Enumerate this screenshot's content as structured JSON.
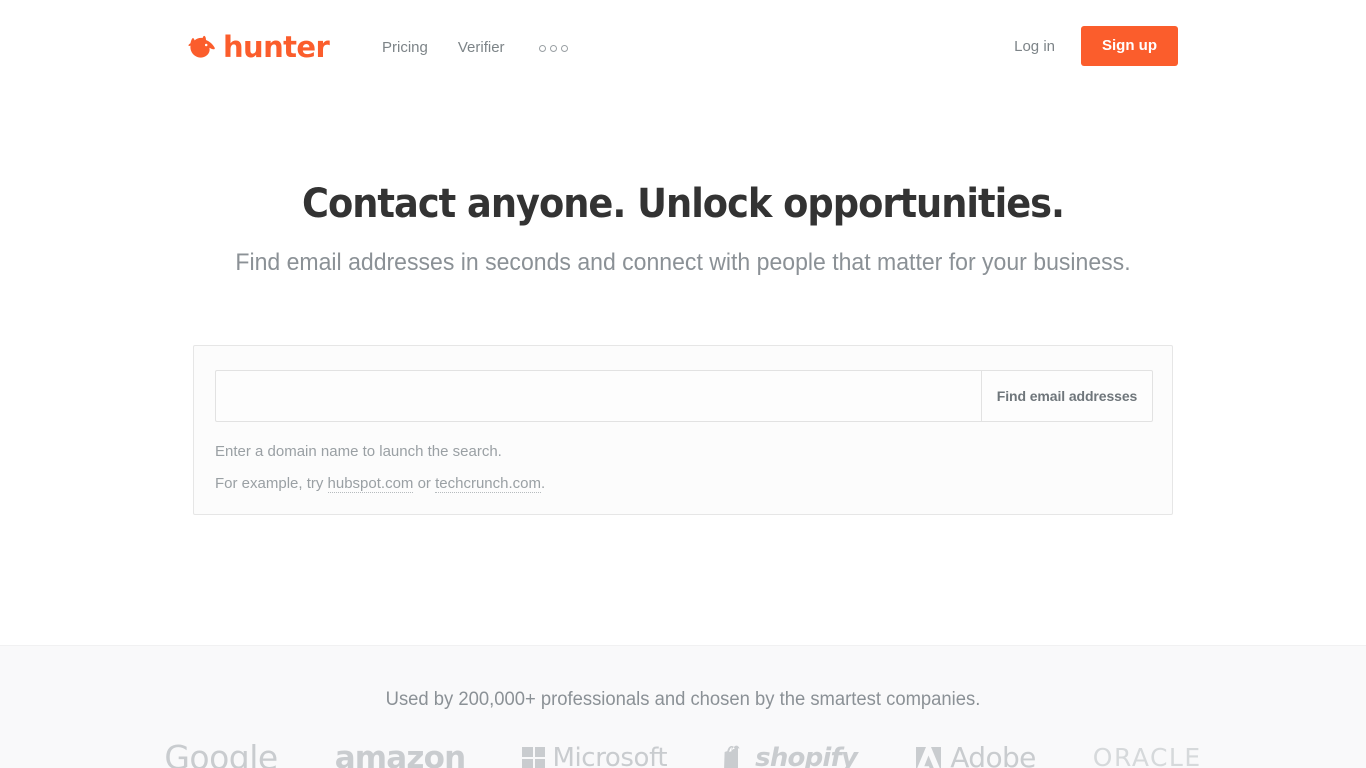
{
  "brand": {
    "name": "hunter",
    "icon": "fox-head-icon",
    "color": "#fb5d2c"
  },
  "header": {
    "nav": [
      {
        "label": "Pricing",
        "name": "pricing"
      },
      {
        "label": "Verifier",
        "name": "verifier"
      }
    ],
    "more_icon": "three-dots-icon",
    "login_label": "Log in",
    "signup_label": "Sign up",
    "signup_color": "#fb5d2c"
  },
  "hero": {
    "title": "Contact anyone. Unlock opportunities.",
    "subtitle": "Find email addresses in seconds and connect with people that matter for your business."
  },
  "search": {
    "value": "",
    "placeholder": "",
    "button_label": "Find email addresses",
    "hint": "Enter a domain name to launch the search.",
    "example_prefix": "For example, try ",
    "example_link_1": "hubspot.com",
    "example_separator": " or ",
    "example_link_2": "techcrunch.com",
    "example_suffix": "."
  },
  "proof": {
    "text": "Used by 200,000+ professionals and chosen by the smartest companies.",
    "logos": [
      {
        "name": "google",
        "label": "Google"
      },
      {
        "name": "amazon",
        "label": "amazon"
      },
      {
        "name": "microsoft",
        "label": "Microsoft"
      },
      {
        "name": "shopify",
        "label": "shopify"
      },
      {
        "name": "adobe",
        "label": "Adobe"
      },
      {
        "name": "oracle",
        "label": "ORACLE"
      }
    ]
  }
}
